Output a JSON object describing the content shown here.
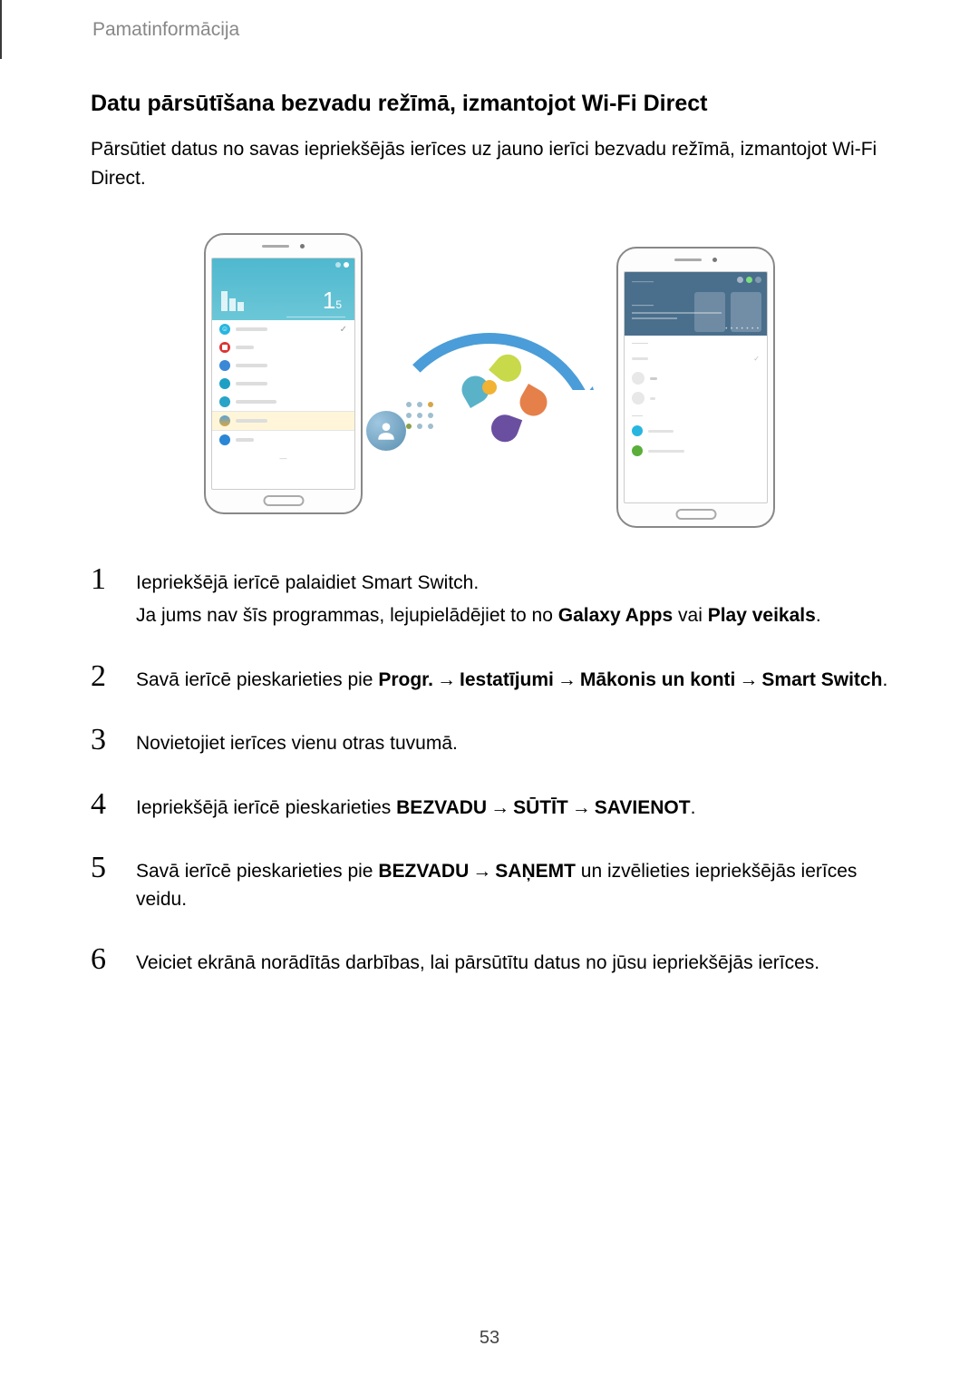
{
  "header": {
    "section_label": "Pamatinformācija"
  },
  "title": "Datu pārsūtīšana bezvadu režīmā, izmantojot Wi-Fi Direct",
  "intro": "Pārsūtiet datus no savas iepriekšējās ierīces uz jauno ierīci bezvadu režīmā, izmantojot Wi-Fi Direct.",
  "steps": {
    "s1": {
      "num": "1",
      "line1": "Iepriekšējā ierīcē palaidiet Smart Switch.",
      "line2_a": "Ja jums nav šīs programmas, lejupielādējiet to no ",
      "line2_b": "Galaxy Apps",
      "line2_c": " vai ",
      "line2_d": "Play veikals",
      "line2_e": "."
    },
    "s2": {
      "num": "2",
      "a": "Savā ierīcē pieskarieties pie ",
      "b1": "Progr.",
      "arr1": "→",
      "b2": "Iestatījumi",
      "arr2": "→",
      "b3": "Mākonis un konti",
      "arr3": "→",
      "b4": "Smart Switch",
      "z": "."
    },
    "s3": {
      "num": "3",
      "text": "Novietojiet ierīces vienu otras tuvumā."
    },
    "s4": {
      "num": "4",
      "a": "Iepriekšējā ierīcē pieskarieties ",
      "b1": "BEZVADU",
      "arr1": "→",
      "b2": "SŪTĪT",
      "arr2": "→",
      "b3": "SAVIENOT",
      "z": "."
    },
    "s5": {
      "num": "5",
      "a": "Savā ierīcē pieskarieties pie ",
      "b1": "BEZVADU",
      "arr1": "→",
      "b2": "SAŅEMT",
      "z": " un izvēlieties iepriekšējās ierīces veidu."
    },
    "s6": {
      "num": "6",
      "text": "Veiciet ekrānā norādītās darbības, lai pārsūtītu datus no jūsu iepriekšējās ierīces."
    }
  },
  "page_number": "53"
}
